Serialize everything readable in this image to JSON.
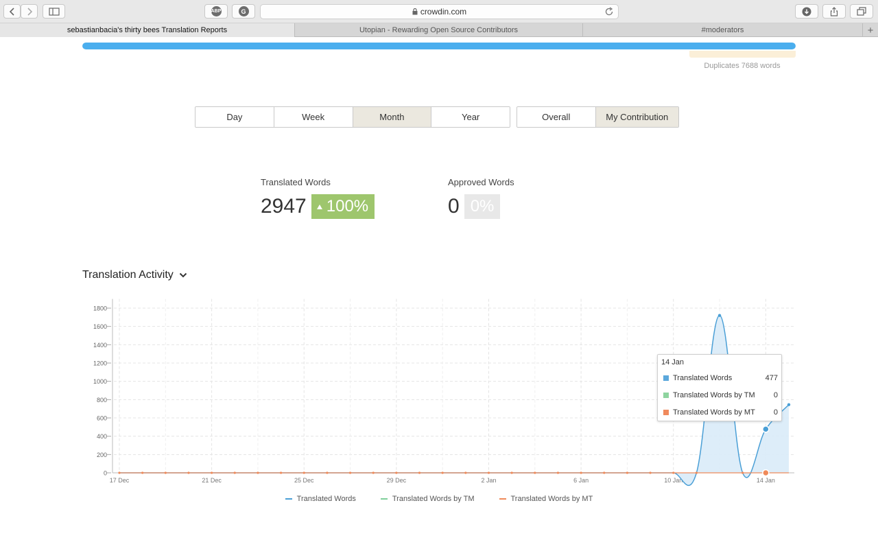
{
  "browser": {
    "url": "crowdin.com",
    "ext_abp_label": "ABP",
    "ext_g_label": "G",
    "tabs": [
      {
        "label": "sebastianbacia's thirty bees Translation Reports",
        "active": true
      },
      {
        "label": "Utopian - Rewarding Open Source Contributors",
        "active": false
      },
      {
        "label": "#moderators",
        "active": false
      }
    ],
    "new_tab_label": "+"
  },
  "progress": {
    "fill_fraction": 1.0,
    "color": "#4aaeee",
    "duplicates_label": "Duplicates 7688 words"
  },
  "period_buttons": [
    {
      "label": "Day",
      "active": false
    },
    {
      "label": "Week",
      "active": false
    },
    {
      "label": "Month",
      "active": true
    },
    {
      "label": "Year",
      "active": false
    }
  ],
  "scope_buttons": [
    {
      "label": "Overall",
      "active": false
    },
    {
      "label": "My Contribution",
      "active": true
    }
  ],
  "stats": {
    "translated": {
      "label": "Translated Words",
      "value": "2947",
      "change": "100%"
    },
    "approved": {
      "label": "Approved Words",
      "value": "0",
      "change": "0%"
    }
  },
  "section": {
    "title": "Translation Activity"
  },
  "chart_data": {
    "type": "area",
    "x": [
      "17 Dec",
      "18 Dec",
      "19 Dec",
      "20 Dec",
      "21 Dec",
      "22 Dec",
      "23 Dec",
      "24 Dec",
      "25 Dec",
      "26 Dec",
      "27 Dec",
      "28 Dec",
      "29 Dec",
      "30 Dec",
      "31 Dec",
      "1 Jan",
      "2 Jan",
      "3 Jan",
      "4 Jan",
      "5 Jan",
      "6 Jan",
      "7 Jan",
      "8 Jan",
      "9 Jan",
      "10 Jan",
      "11 Jan",
      "12 Jan",
      "13 Jan",
      "14 Jan",
      "15 Jan"
    ],
    "x_tick_labels": [
      "17 Dec",
      "21 Dec",
      "25 Dec",
      "29 Dec",
      "2 Jan",
      "6 Jan",
      "10 Jan",
      "14 Jan"
    ],
    "y_ticks": [
      0,
      200,
      400,
      600,
      800,
      1000,
      1200,
      1400,
      1600,
      1800
    ],
    "ylim": [
      0,
      1900
    ],
    "grid": true,
    "legend_position": "bottom",
    "series": [
      {
        "name": "Translated Words",
        "color": "#4a9fd6",
        "values": [
          0,
          0,
          0,
          0,
          0,
          0,
          0,
          0,
          0,
          0,
          0,
          0,
          0,
          0,
          0,
          0,
          0,
          0,
          0,
          0,
          0,
          0,
          0,
          0,
          0,
          0,
          1720,
          0,
          477,
          745
        ]
      },
      {
        "name": "Translated Words by TM",
        "color": "#7fcf9a",
        "values": [
          0,
          0,
          0,
          0,
          0,
          0,
          0,
          0,
          0,
          0,
          0,
          0,
          0,
          0,
          0,
          0,
          0,
          0,
          0,
          0,
          0,
          0,
          0,
          0,
          0,
          0,
          0,
          0,
          0,
          0
        ]
      },
      {
        "name": "Translated Words by MT",
        "color": "#ef8a5a",
        "values": [
          0,
          0,
          0,
          0,
          0,
          0,
          0,
          0,
          0,
          0,
          0,
          0,
          0,
          0,
          0,
          0,
          0,
          0,
          0,
          0,
          0,
          0,
          0,
          0,
          0,
          0,
          0,
          0,
          0,
          0
        ]
      }
    ],
    "tooltip": {
      "title": "14 Jan",
      "rows": [
        {
          "name": "Translated Words",
          "value": "477",
          "color": "#5ba8dc"
        },
        {
          "name": "Translated Words by TM",
          "value": "0",
          "color": "#8ed49f"
        },
        {
          "name": "Translated Words by MT",
          "value": "0",
          "color": "#f08a5d"
        }
      ]
    }
  }
}
